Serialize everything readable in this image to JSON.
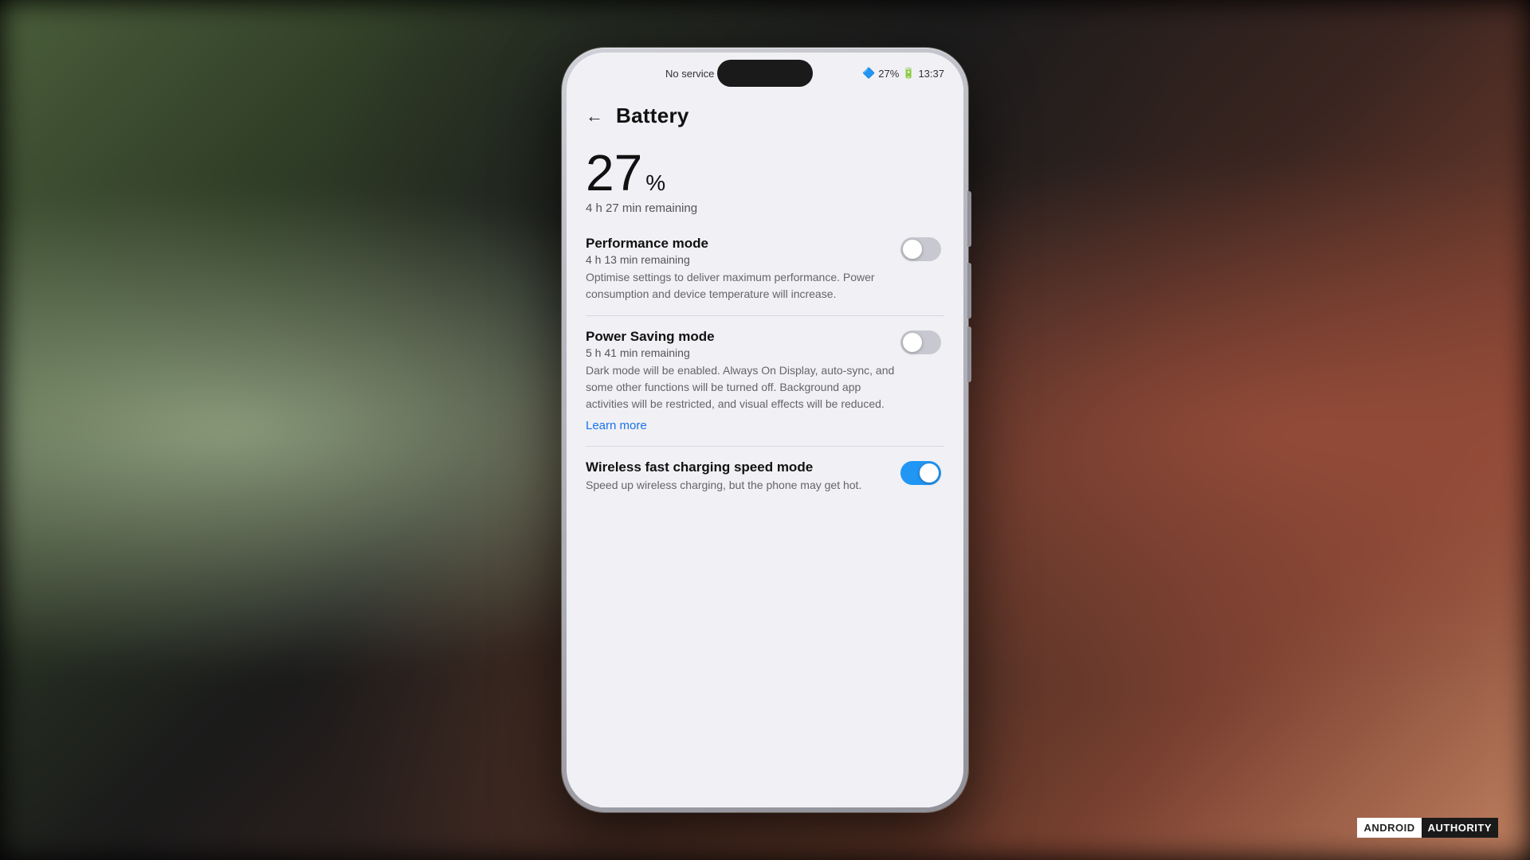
{
  "background": {
    "description": "blurred bokeh background with plants and person"
  },
  "statusBar": {
    "service": "No service",
    "bluetooth": "27%",
    "time": "13:37"
  },
  "page": {
    "title": "Battery"
  },
  "battery": {
    "percent": "27",
    "symbol": "%",
    "remaining": "4 h 27 min remaining"
  },
  "performanceMode": {
    "title": "Performance mode",
    "subtitle": "4 h 13 min remaining",
    "description": "Optimise settings to deliver maximum performance. Power consumption and device temperature will increase.",
    "enabled": false
  },
  "powerSavingMode": {
    "title": "Power Saving mode",
    "subtitle": "5 h 41 min remaining",
    "description": "Dark mode will be enabled. Always On Display, auto-sync, and some other functions will be turned off. Background app activities will be restricted, and visual effects will be reduced.",
    "enabled": false,
    "learnMore": "Learn more"
  },
  "wirelessCharging": {
    "title": "Wireless fast charging speed mode",
    "description": "Speed up wireless charging, but the phone may get hot.",
    "enabled": true
  },
  "watermark": {
    "android": "ANDROID",
    "authority": "AUTHORITY"
  }
}
